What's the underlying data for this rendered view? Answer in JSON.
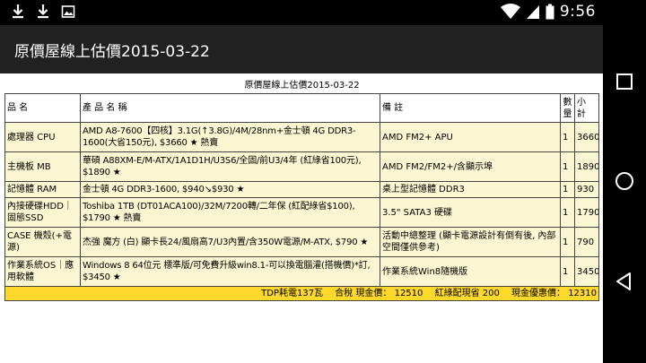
{
  "status_bar": {
    "time": "9:56",
    "icons": [
      "download-icon",
      "download-icon",
      "image-icon",
      "wifi-icon",
      "signal-icon",
      "battery-icon"
    ]
  },
  "app_bar": {
    "title": "原價屋線上估價2015-03-22"
  },
  "quote_table": {
    "title": "原價屋線上估價2015-03-22",
    "headers": {
      "category": "品 名",
      "product": "產 品 名 稱",
      "note": "備 註",
      "qty": "數量",
      "subtotal": "小 計"
    },
    "rows": [
      {
        "category": "處理器 CPU",
        "product": "AMD A8-7600【四核】3.1G(↑3.8G)/4M/28nm+金士頓 4G DDR3-1600(大省150元), $3660 ★ 熱賣",
        "note": "AMD FM2+ APU",
        "qty": "1",
        "subtotal": "3660"
      },
      {
        "category": "主機板 MB",
        "product": "華碩 A88XM-E/M-ATX/1A1D1H/U3S6/全固/前U3/4年 (紅綠省100元), $1890 ★",
        "note": "AMD FM2/FM2+/含顯示埠",
        "qty": "1",
        "subtotal": "1890"
      },
      {
        "category": "記憶體 RAM",
        "product": "金士頓 4G DDR3-1600, $940↘$930 ★",
        "note": "桌上型記憶體 DDR3",
        "qty": "1",
        "subtotal": "930"
      },
      {
        "category": "內接硬碟HDD｜固態SSD",
        "product": "Toshiba 1TB (DT01ACA100)/32M/7200轉/二年保 (紅配綠省$100), $1790 ★ 熱賣",
        "note": "3.5\" SATA3 硬碟",
        "qty": "1",
        "subtotal": "1790"
      },
      {
        "category": "CASE 機殼(+電源)",
        "product": "杰強 魔方 (白) 顯卡長24/風扇高7/U3內置/含350W電源/M-ATX, $790 ★",
        "note": "活動中總整理 (顯卡電源設計有倒有後, 內部空間僅供參考)",
        "qty": "1",
        "subtotal": "790"
      },
      {
        "category": "作業系統OS｜應用軟體",
        "product": "Windows 8 64位元 標準版/可免費升級win8.1-可以換電腦灌(搭機價)*訂, $3450 ★",
        "note": "作業系統Win8隨機版",
        "qty": "1",
        "subtotal": "3450"
      }
    ],
    "total_line": "TDP耗電137瓦　 合稅 現金價： 12510　 紅綠配現省 200　 現金優惠價： 12310"
  },
  "nav_bar": {
    "buttons": [
      "recents-button",
      "home-button",
      "back-button"
    ]
  },
  "colors": {
    "row_bg": "#fbf6d2",
    "total_bg": "#fed82a",
    "app_bar_bg": "#212121"
  }
}
